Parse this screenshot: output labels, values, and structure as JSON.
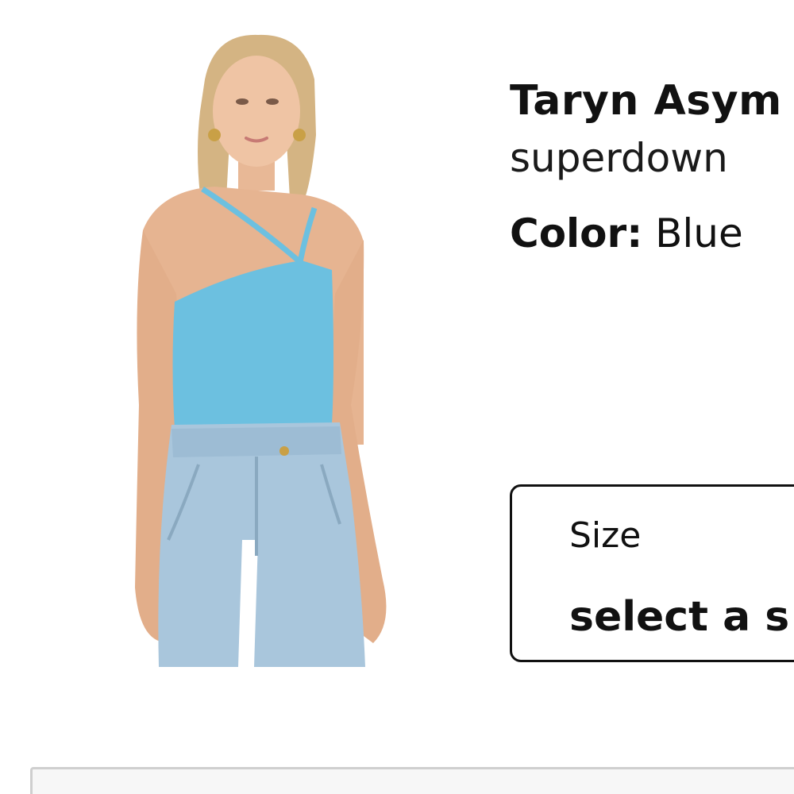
{
  "product": {
    "image_alt": "Model wearing blue asymmetric one-shoulder bodysuit with light wash jeans",
    "title": "Taryn Asym",
    "brand": "superdown",
    "color_key": "Color:",
    "color_value": "Blue",
    "garment_color": "#6cc0e0",
    "denim_color": "#a9c6dc"
  },
  "size_selector": {
    "label": "Size",
    "value": "select a s"
  }
}
